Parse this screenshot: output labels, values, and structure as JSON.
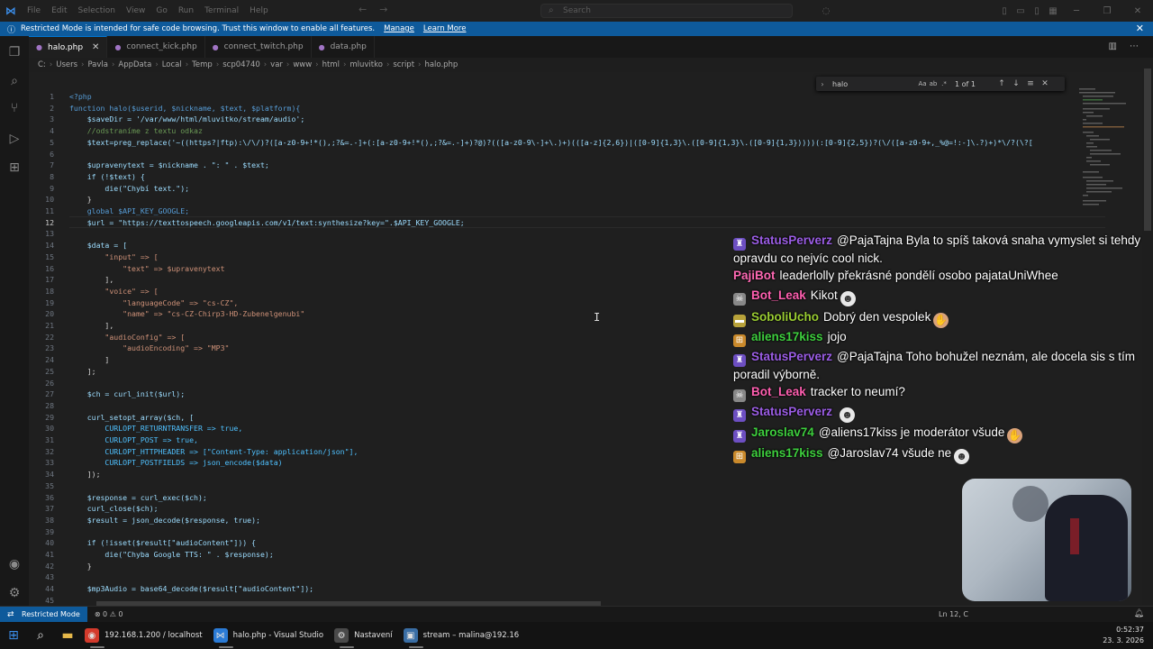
{
  "titlebar": {
    "menu": [
      "File",
      "Edit",
      "Selection",
      "View",
      "Go",
      "Run",
      "Terminal",
      "Help"
    ],
    "search_placeholder": "Search"
  },
  "banner": {
    "text": "Restricted Mode is intended for safe code browsing. Trust this window to enable all features.",
    "manage": "Manage",
    "learn_more": "Learn More"
  },
  "tabs": [
    {
      "label": "halo.php",
      "active": true
    },
    {
      "label": "connect_kick.php",
      "active": false
    },
    {
      "label": "connect_twitch.php",
      "active": false
    },
    {
      "label": "data.php",
      "active": false
    }
  ],
  "breadcrumb": [
    "C:",
    "Users",
    "Pavla",
    "AppData",
    "Local",
    "Temp",
    "scp04740",
    "var",
    "www",
    "html",
    "mluvitko",
    "script",
    "halo.php"
  ],
  "find": {
    "query": "halo",
    "count": "1 of 1",
    "opt_case": "Aa",
    "opt_word": "ab",
    "opt_regex": ".*"
  },
  "code": {
    "current_line": 12,
    "lines": [
      {
        "n": 1,
        "text": "<?php"
      },
      {
        "n": 2,
        "text": "function halo($userid, $nickname, $text, $platform){"
      },
      {
        "n": 3,
        "text": "    $saveDir = '/var/www/html/mluvitko/stream/audio';"
      },
      {
        "n": 4,
        "text": "    //odstraníme z textu odkaz"
      },
      {
        "n": 5,
        "text": "    $text=preg_replace('~((https?|ftp):\\/\\/)?([a-z0-9+!*(),;?&=.-]+(:[a-z0-9+!*(),;?&=.-]+)?@)?(([a-z0-9\\-]+\\.)+)(([a-z]{2,6})|([0-9]{1,3}\\.([0-9]{1,3}\\.([0-9]{1,3}))))(:[0-9]{2,5})?(\\/([a-z0-9+,_%@=!:-]\\.?)+)*\\/?(\\?["
      },
      {
        "n": 6,
        "text": ""
      },
      {
        "n": 7,
        "text": "    $upravenytext = $nickname . \": \" . $text;"
      },
      {
        "n": 8,
        "text": "    if (!$text) {"
      },
      {
        "n": 9,
        "text": "        die(\"Chybí text.\");"
      },
      {
        "n": 10,
        "text": "    }"
      },
      {
        "n": 11,
        "text": "    global $API_KEY_GOOGLE;"
      },
      {
        "n": 12,
        "text": "    $url = \"https://texttospeech.googleapis.com/v1/text:synthesize?key=\".$API_KEY_GOOGLE;"
      },
      {
        "n": 13,
        "text": ""
      },
      {
        "n": 14,
        "text": "    $data = ["
      },
      {
        "n": 15,
        "text": "        \"input\" => ["
      },
      {
        "n": 16,
        "text": "            \"text\" => $upravenytext"
      },
      {
        "n": 17,
        "text": "        ],"
      },
      {
        "n": 18,
        "text": "        \"voice\" => ["
      },
      {
        "n": 19,
        "text": "            \"languageCode\" => \"cs-CZ\","
      },
      {
        "n": 20,
        "text": "            \"name\" => \"cs-CZ-Chirp3-HD-Zubenelgenubi\""
      },
      {
        "n": 21,
        "text": "        ],"
      },
      {
        "n": 22,
        "text": "        \"audioConfig\" => ["
      },
      {
        "n": 23,
        "text": "            \"audioEncoding\" => \"MP3\""
      },
      {
        "n": 24,
        "text": "        ]"
      },
      {
        "n": 25,
        "text": "    ];"
      },
      {
        "n": 26,
        "text": ""
      },
      {
        "n": 27,
        "text": "    $ch = curl_init($url);"
      },
      {
        "n": 28,
        "text": ""
      },
      {
        "n": 29,
        "text": "    curl_setopt_array($ch, ["
      },
      {
        "n": 30,
        "text": "        CURLOPT_RETURNTRANSFER => true,"
      },
      {
        "n": 31,
        "text": "        CURLOPT_POST => true,"
      },
      {
        "n": 32,
        "text": "        CURLOPT_HTTPHEADER => [\"Content-Type: application/json\"],"
      },
      {
        "n": 33,
        "text": "        CURLOPT_POSTFIELDS => json_encode($data)"
      },
      {
        "n": 34,
        "text": "    ]);"
      },
      {
        "n": 35,
        "text": ""
      },
      {
        "n": 36,
        "text": "    $response = curl_exec($ch);"
      },
      {
        "n": 37,
        "text": "    curl_close($ch);"
      },
      {
        "n": 38,
        "text": "    $result = json_decode($response, true);"
      },
      {
        "n": 39,
        "text": ""
      },
      {
        "n": 40,
        "text": "    if (!isset($result[\"audioContent\"])) {"
      },
      {
        "n": 41,
        "text": "        die(\"Chyba Google TTS: \" . $response);"
      },
      {
        "n": 42,
        "text": "    }"
      },
      {
        "n": 43,
        "text": ""
      },
      {
        "n": 44,
        "text": "    $mp3Audio = base64_decode($result[\"audioContent\"]);"
      },
      {
        "n": 45,
        "text": ""
      }
    ]
  },
  "chat": [
    {
      "badge": "♜",
      "badge_color": "#6d4fc2",
      "nick": "StatusPerverz",
      "nick_color": "#9b5de5",
      "text": "@PajaTajna Byla to spíš taková snaha vymyslet si tehdy opravdu co nejvíc cool nick.",
      "emote": ""
    },
    {
      "badge": "",
      "badge_color": "",
      "nick": "PajiBot",
      "nick_color": "#ff69b4",
      "text": "leaderlolly překrásné pondělí osobo pajataUniWhee",
      "emote": ""
    },
    {
      "badge": "☠",
      "badge_color": "#888888",
      "nick": "Bot_Leak",
      "nick_color": "#ff5fb0",
      "text": "Kikot",
      "emote": "☻"
    },
    {
      "badge": "▬",
      "badge_color": "#b8a23a",
      "nick": "SoboliUcho",
      "nick_color": "#9acd32",
      "text": "Dobrý den vespolek",
      "emote": "✋"
    },
    {
      "badge": "⊞",
      "badge_color": "#c9892b",
      "nick": "aliens17kiss",
      "nick_color": "#3ecf3e",
      "text": "jojo",
      "emote": ""
    },
    {
      "badge": "♜",
      "badge_color": "#6d4fc2",
      "nick": "StatusPerverz",
      "nick_color": "#9b5de5",
      "text": "@PajaTajna Toho bohužel neznám, ale docela sis s tím poradil výborně.",
      "emote": ""
    },
    {
      "badge": "☠",
      "badge_color": "#888888",
      "nick": "Bot_Leak",
      "nick_color": "#ff5fb0",
      "text": "tracker to neumí?",
      "emote": ""
    },
    {
      "badge": "♜",
      "badge_color": "#6d4fc2",
      "nick": "StatusPerverz",
      "nick_color": "#9b5de5",
      "text": "",
      "emote": "☻"
    },
    {
      "badge": "♜",
      "badge_color": "#6d4fc2",
      "nick": "Jaroslav74",
      "nick_color": "#3ecf3e",
      "text": "@aliens17kiss je moderátor všude",
      "emote": "✋"
    },
    {
      "badge": "⊞",
      "badge_color": "#c9892b",
      "nick": "aliens17kiss",
      "nick_color": "#3ecf3e",
      "text": "@Jaroslav74 všude ne",
      "emote": "☻"
    }
  ],
  "statusbar": {
    "restricted": "Restricted Mode",
    "problems": "⊗ 0 ⚠ 0",
    "position": "Ln 12, C"
  },
  "taskbar": {
    "apps": [
      {
        "label": "192.168.1.200 / localhost",
        "icon": "◉",
        "color": "#d33a2c"
      },
      {
        "label": "halo.php - Visual Studio",
        "icon": "⋈",
        "color": "#2b7bd6"
      },
      {
        "label": "Nastavení",
        "icon": "⚙",
        "color": "#4a4a4a"
      },
      {
        "label": "stream – malina@192.16",
        "icon": "▣",
        "color": "#3a6ea5"
      }
    ],
    "time": "0:52:37",
    "date": "23. 3. 2026"
  }
}
